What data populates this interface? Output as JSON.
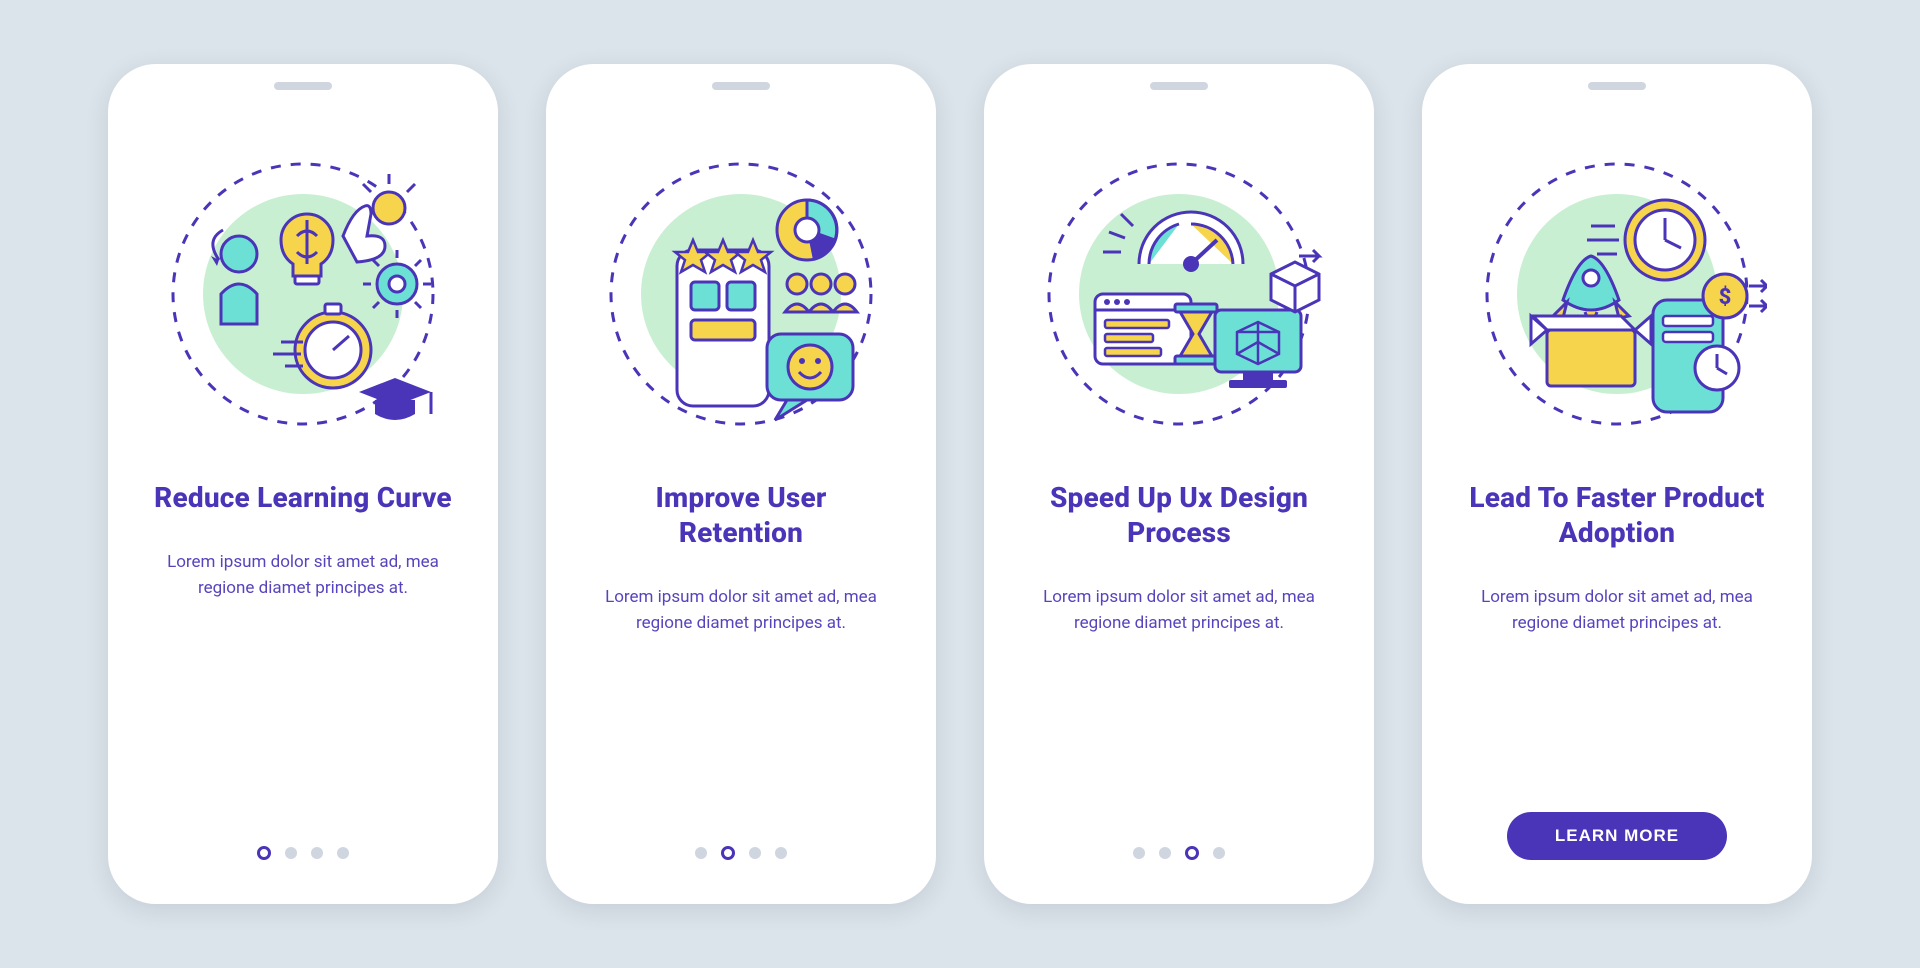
{
  "colors": {
    "background": "#dbe4ea",
    "card": "#ffffff",
    "primary": "#4a34b8",
    "accent_yellow": "#f6d44b",
    "accent_teal": "#6de0d6",
    "accent_green_soft": "#c9efd2",
    "dot_inactive": "#cfd6df"
  },
  "screens": [
    {
      "icon": "learning-curve-icon",
      "title": "Reduce Learning Curve",
      "desc": "Lorem ipsum dolor sit amet ad, mea regione diamet principes at.",
      "active_index": 0,
      "total_dots": 4,
      "cta": null
    },
    {
      "icon": "user-retention-icon",
      "title": "Improve User Retention",
      "desc": "Lorem ipsum dolor sit amet ad, mea regione diamet principes at.",
      "active_index": 1,
      "total_dots": 4,
      "cta": null
    },
    {
      "icon": "ux-speed-icon",
      "title": "Speed Up Ux Design Process",
      "desc": "Lorem ipsum dolor sit amet ad, mea regione diamet principes at.",
      "active_index": 2,
      "total_dots": 4,
      "cta": null
    },
    {
      "icon": "product-adoption-icon",
      "title": "Lead To Faster Product Adoption",
      "desc": "Lorem ipsum dolor sit amet ad, mea regione diamet principes at.",
      "active_index": 3,
      "total_dots": 4,
      "cta": "LEARN MORE"
    }
  ]
}
